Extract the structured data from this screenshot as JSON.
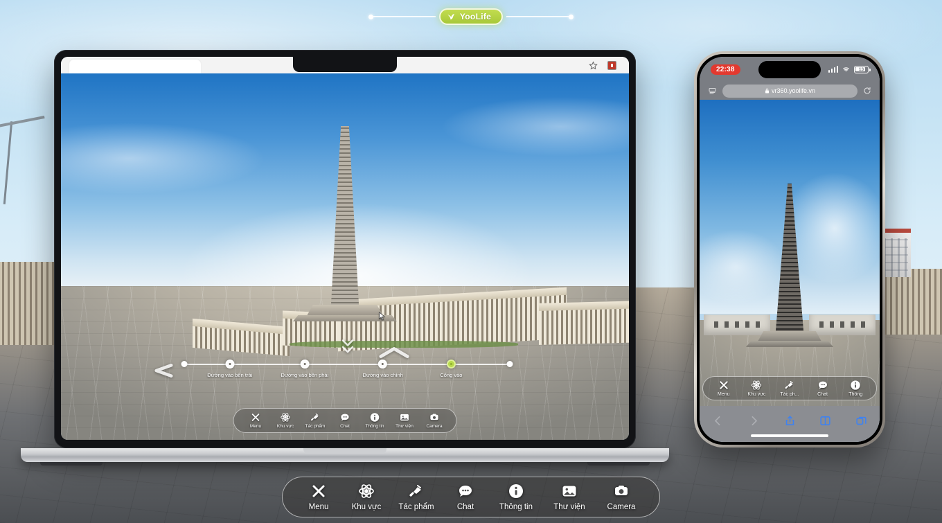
{
  "brand": {
    "name": "YooLife",
    "logo_icon": "yoolife-bird-icon",
    "pill_color": "#b4d13f"
  },
  "background": {
    "scene": "360 panorama of memorial monument plaza",
    "description": "Outdoor plaza with obelisk monument, colonnaded buildings and paved ground"
  },
  "laptop": {
    "browser": {
      "tab_title": "",
      "star_icon": "bookmark-star-icon",
      "extension_icon": "extension-icon"
    },
    "vr_scene": {
      "title": "VR360 memorial plaza panorama"
    },
    "timeline": {
      "nodes": [
        {
          "label": "Đường vào bên trái",
          "position": 14,
          "active": false
        },
        {
          "label": "Đường vào bên phải",
          "position": 37,
          "active": false
        },
        {
          "label": "Đường vào chính",
          "position": 61,
          "active": false
        },
        {
          "label": "Cổng vào",
          "position": 82,
          "active": true
        }
      ],
      "start_marker": "start-dot",
      "end_marker": "end-dot"
    },
    "nav_arrows": {
      "left_chevron": "chevron-left-ground-icon",
      "up_chevron": "chevron-up-ground-icon",
      "down_double_chevron": "chevron-double-down-icon"
    },
    "toolbar": {
      "items": [
        {
          "label": "Menu",
          "icon": "close-x-icon"
        },
        {
          "label": "Khu vực",
          "icon": "atom-area-icon"
        },
        {
          "label": "Tác phẩm",
          "icon": "artwork-icon"
        },
        {
          "label": "Chat",
          "icon": "chat-bubble-icon"
        },
        {
          "label": "Thông tin",
          "icon": "info-circle-icon"
        },
        {
          "label": "Thư viện",
          "icon": "gallery-image-icon"
        },
        {
          "label": "Camera",
          "icon": "camera-icon"
        }
      ]
    }
  },
  "phone": {
    "status_bar": {
      "time": "22:38",
      "recording": true,
      "signal_icon": "cellular-signal-icon",
      "wifi_icon": "wifi-icon",
      "battery_icon": "battery-icon",
      "battery_level": "13"
    },
    "browser": {
      "url": "vr360.yoolife.vn",
      "lock_icon": "lock-icon",
      "reader_icon": "reader-view-icon",
      "reload_icon": "reload-icon"
    },
    "toolbar": {
      "items": [
        {
          "label": "Menu",
          "icon": "close-x-icon"
        },
        {
          "label": "Khu vực",
          "icon": "atom-area-icon"
        },
        {
          "label": "Tác ph...",
          "icon": "artwork-icon"
        },
        {
          "label": "Chat",
          "icon": "chat-bubble-icon"
        },
        {
          "label": "Thông",
          "icon": "info-circle-icon"
        }
      ]
    },
    "safari_bar": {
      "back_icon": "chevron-back-icon",
      "forward_icon": "chevron-forward-icon",
      "share_icon": "share-icon",
      "bookmarks_icon": "book-bookmarks-icon",
      "tabs_icon": "tabs-icon"
    }
  },
  "overlay_toolbar": {
    "items": [
      {
        "label": "Menu",
        "icon": "close-x-icon"
      },
      {
        "label": "Khu vực",
        "icon": "atom-area-icon"
      },
      {
        "label": "Tác phẩm",
        "icon": "artwork-icon"
      },
      {
        "label": "Chat",
        "icon": "chat-bubble-icon"
      },
      {
        "label": "Thông tin",
        "icon": "info-circle-icon"
      },
      {
        "label": "Thư viện",
        "icon": "gallery-image-icon"
      },
      {
        "label": "Camera",
        "icon": "camera-icon"
      }
    ]
  }
}
